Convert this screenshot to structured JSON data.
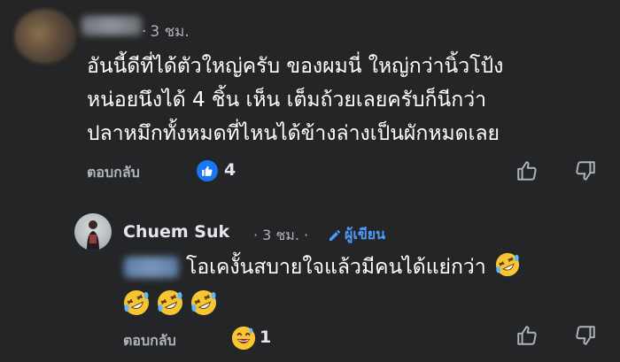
{
  "comment1": {
    "time": "3 ชม.",
    "text_lines": [
      "อันนี้ดีที่ได้ตัวใหญ่ครับ ของผมนี่ ใหญ่กว่านิ้วโป้ง",
      "หน่อยนึงได้ 4 ชิ้น เห็น เต็มถ้วยเลยครับก็นีกว่า",
      "ปลาหมึกทั้งหมดที่ไหนได้ข้างล่างเป็นผักหมดเลย"
    ],
    "reply_label": "ตอบกลับ",
    "reaction_icon": "like-icon",
    "reaction_count": "4"
  },
  "comment2": {
    "author": "Chuem Suk",
    "time": "3 ชม.",
    "author_badge": "ผู้เขียน",
    "text": "โอเคงั้นสบายใจแล้วมีคนได้แย่กว่า",
    "emoji_icon": "rofl-emoji",
    "emoji_row_count": 3,
    "reply_label": "ตอบกลับ",
    "reaction_icon": "grin-sweat-emoji",
    "reaction_count": "1"
  },
  "colors": {
    "background": "#242526",
    "text_primary": "#ffffff",
    "text_secondary": "#b0b3b8",
    "accent": "#4c9bff",
    "like_blue": "#1877f2"
  }
}
